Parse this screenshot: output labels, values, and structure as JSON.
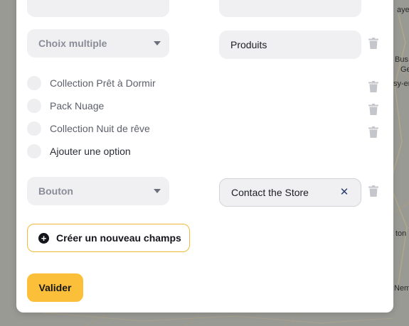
{
  "map": {
    "labels": [
      "aye-",
      "Bus",
      "Ge",
      "sy-en",
      "ton",
      "Nem"
    ]
  },
  "form": {
    "row1": {
      "type_placeholder": "Choix multiple",
      "field_value": "Produits"
    },
    "options": [
      {
        "label": "Collection Prêt à Dormir"
      },
      {
        "label": "Pack Nuage"
      },
      {
        "label": "Collection Nuit de rêve"
      }
    ],
    "add_option_label": "Ajouter une option",
    "row2": {
      "type_placeholder": "Bouton",
      "field_value": "Contact the Store"
    },
    "create_field_label": "Créer un nouveau champs",
    "validate_label": "Valider"
  },
  "colors": {
    "accent": "#fbbf3a",
    "accent_border": "#f4b93a",
    "field_bg": "#f0f0f2",
    "close_icon": "#2c3e6b"
  }
}
